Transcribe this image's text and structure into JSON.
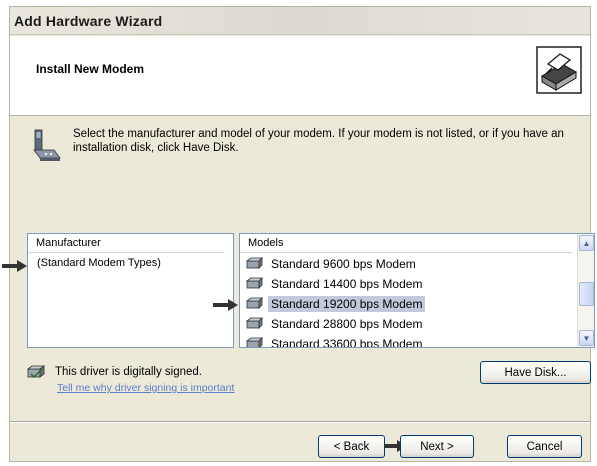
{
  "window": {
    "title": "Add Hardware Wizard"
  },
  "header": {
    "title": "Install New Modem",
    "icon": "hardware-wizard-icon"
  },
  "instructions": "Select the manufacturer and model of your modem. If your modem is not listed, or if you have an installation disk, click Have Disk.",
  "manufacturer": {
    "header": "Manufacturer",
    "items": [
      "(Standard Modem Types)"
    ],
    "selected": "(Standard Modem Types)"
  },
  "models": {
    "header": "Models",
    "items": [
      {
        "label": "Standard  9600 bps Modem"
      },
      {
        "label": "Standard 14400 bps Modem"
      },
      {
        "label": "Standard 19200 bps Modem",
        "selected": true
      },
      {
        "label": "Standard 28800 bps Modem"
      },
      {
        "label": "Standard 33600 bps Modem"
      }
    ]
  },
  "driver": {
    "signed_text": "This driver is digitally signed.",
    "link_text": "Tell me why driver signing is important"
  },
  "buttons": {
    "have_disk": "Have Disk...",
    "back": "< Back",
    "next": "Next >",
    "cancel": "Cancel"
  },
  "colors": {
    "dialog_bg": "#ece9d8",
    "selection": "#c1c9dd",
    "link": "#5c7ecb",
    "button_border": "#003c74"
  }
}
